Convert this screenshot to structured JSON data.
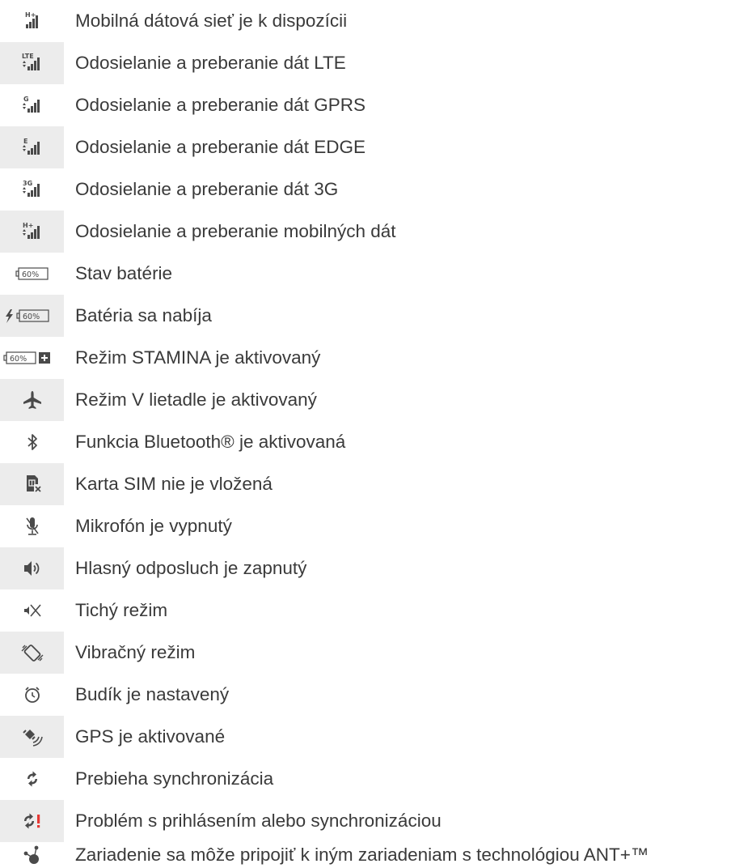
{
  "items": [
    {
      "icon": "signal-h-plus-icon",
      "label": "Mobilná dátová sieť je k dispozícii",
      "shaded": false
    },
    {
      "icon": "signal-lte-transfer-icon",
      "label": "Odosielanie a preberanie dát LTE",
      "shaded": true
    },
    {
      "icon": "signal-gprs-transfer-icon",
      "label": "Odosielanie a preberanie dát GPRS",
      "shaded": false
    },
    {
      "icon": "signal-edge-transfer-icon",
      "label": "Odosielanie a preberanie dát EDGE",
      "shaded": true
    },
    {
      "icon": "signal-3g-transfer-icon",
      "label": "Odosielanie a preberanie dát 3G",
      "shaded": false
    },
    {
      "icon": "signal-h-plus-transfer-icon",
      "label": "Odosielanie a preberanie mobilných dát",
      "shaded": true
    },
    {
      "icon": "battery-status-icon",
      "label": "Stav batérie",
      "shaded": false
    },
    {
      "icon": "battery-charging-icon",
      "label": "Batéria sa nabíja",
      "shaded": true
    },
    {
      "icon": "stamina-mode-icon",
      "label": "Režim STAMINA je aktivovaný",
      "shaded": false
    },
    {
      "icon": "airplane-mode-icon",
      "label": "Režim V lietadle je aktivovaný",
      "shaded": true
    },
    {
      "icon": "bluetooth-icon",
      "label": "Funkcia Bluetooth® je aktivovaná",
      "shaded": false
    },
    {
      "icon": "no-sim-card-icon",
      "label": "Karta SIM nie je vložená",
      "shaded": true
    },
    {
      "icon": "microphone-muted-icon",
      "label": "Mikrofón je vypnutý",
      "shaded": false
    },
    {
      "icon": "speakerphone-icon",
      "label": "Hlasný odposluch je zapnutý",
      "shaded": true
    },
    {
      "icon": "silent-mode-icon",
      "label": "Tichý režim",
      "shaded": false
    },
    {
      "icon": "vibrate-mode-icon",
      "label": "Vibračný režim",
      "shaded": true
    },
    {
      "icon": "alarm-clock-icon",
      "label": "Budík je nastavený",
      "shaded": false
    },
    {
      "icon": "gps-icon",
      "label": "GPS je aktivované",
      "shaded": true
    },
    {
      "icon": "sync-icon",
      "label": "Prebieha synchronizácia",
      "shaded": false
    },
    {
      "icon": "sync-error-icon",
      "label": "Problém s prihlásením alebo synchronizáciou",
      "shaded": true
    },
    {
      "icon": "ant-plus-icon",
      "label": "Zariadenie sa môže pripojiť k iným zariadeniam s technológiou ANT+™",
      "shaded": false
    }
  ],
  "icon_text": {
    "hplus": "H+",
    "lte": "LTE",
    "g": "G",
    "e": "E",
    "threeg": "3G",
    "battery_level": "60%"
  },
  "colors": {
    "text": "#3a3a3a",
    "icon": "#4a4a4a",
    "row_shade": "#ececec",
    "alert": "#e53935"
  }
}
